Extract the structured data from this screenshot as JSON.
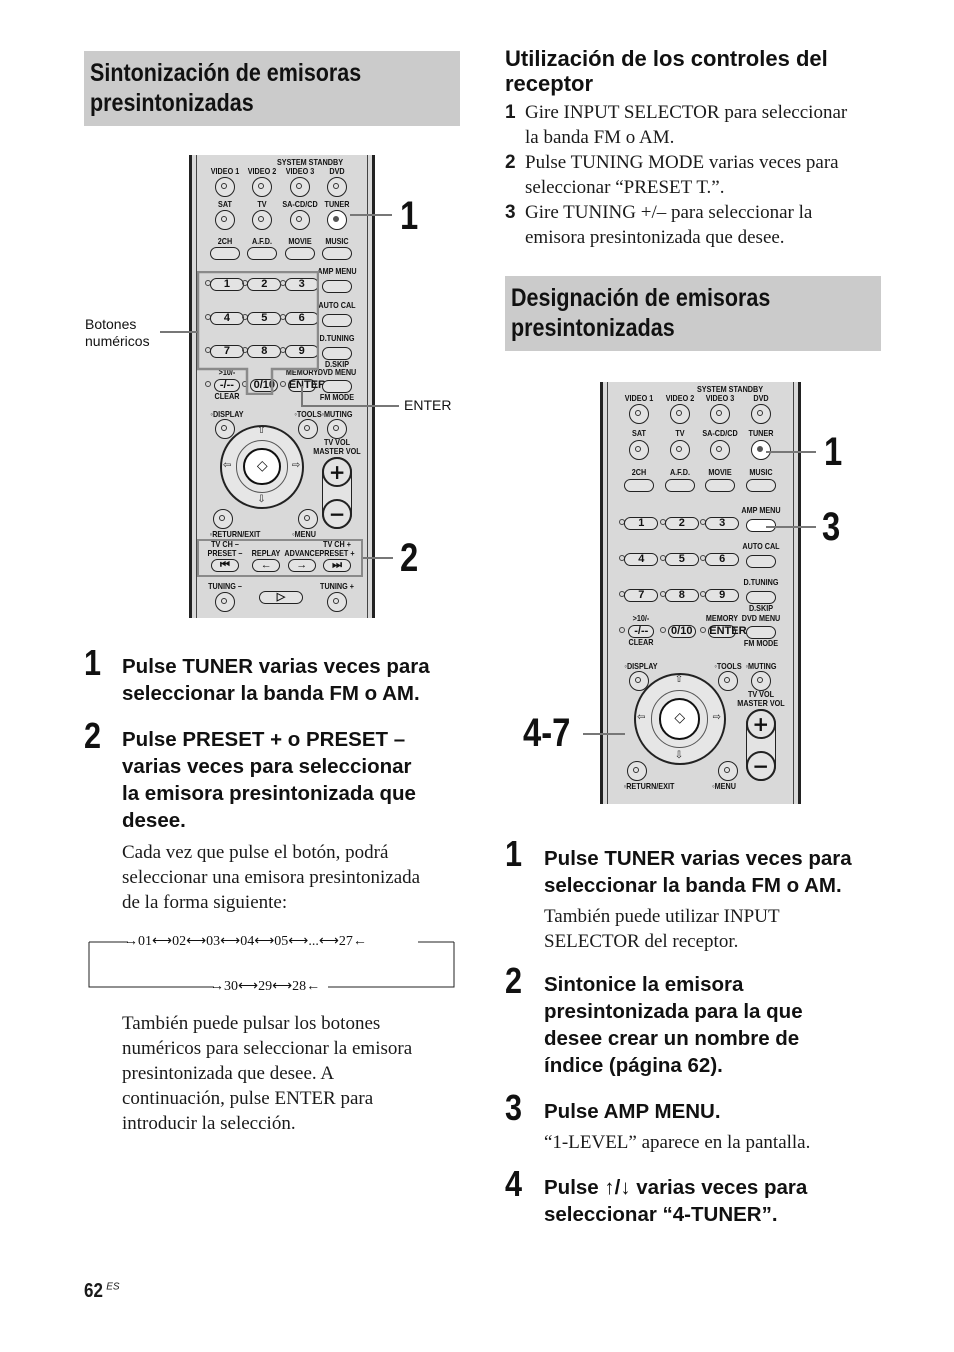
{
  "left": {
    "section_title_line1": "Sintonización de emisoras",
    "section_title_line2": "presintonizadas",
    "annotations": {
      "numeric_buttons_line1": "Botones",
      "numeric_buttons_line2": "numéricos",
      "enter": "ENTER"
    },
    "callouts": [
      "1",
      "2"
    ],
    "steps": [
      {
        "num": "1",
        "title_lines": [
          "Pulse TUNER varias veces para",
          "seleccionar la banda FM o AM."
        ]
      },
      {
        "num": "2",
        "title_lines": [
          "Pulse PRESET + o PRESET –",
          "varias veces para seleccionar",
          "la emisora presintonizada que",
          "desee."
        ],
        "body_lines": [
          "Cada vez que pulse el botón, podrá",
          "seleccionar una emisora presintonizada",
          "de la forma siguiente:"
        ]
      }
    ],
    "sequence": {
      "top": [
        "01",
        "02",
        "03",
        "04",
        "05",
        "...",
        "27"
      ],
      "bottom": [
        "30",
        "29",
        "28"
      ]
    },
    "note_lines": [
      "También puede pulsar los botones",
      "numéricos para seleccionar la emisora",
      "presintonizada que desee. A",
      "continuación, pulse ENTER para",
      "introducir la selección."
    ]
  },
  "right": {
    "subheading_line1": "Utilización de los controles del",
    "subheading_line2": "receptor",
    "receiver_steps": [
      {
        "num": "1",
        "lines": [
          "Gire INPUT SELECTOR para seleccionar",
          "la banda FM o AM."
        ]
      },
      {
        "num": "2",
        "lines": [
          "Pulse TUNING MODE varias veces para",
          "seleccionar “PRESET T.”."
        ]
      },
      {
        "num": "3",
        "lines": [
          "Gire TUNING +/– para seleccionar la",
          "emisora presintonizada que desee."
        ]
      }
    ],
    "section_title_line1": "Designación de emisoras",
    "section_title_line2": "presintonizadas",
    "callouts": [
      "1",
      "3",
      "4-7"
    ],
    "steps": [
      {
        "num": "1",
        "title_lines": [
          "Pulse TUNER varias veces para",
          "seleccionar la banda FM o AM."
        ],
        "body_lines": [
          "También puede utilizar INPUT",
          "SELECTOR del receptor."
        ]
      },
      {
        "num": "2",
        "title_lines": [
          "Sintonice la emisora",
          "presintonizada para la que",
          "desee crear un nombre de",
          "índice (página 62)."
        ]
      },
      {
        "num": "3",
        "title_lines": [
          "Pulse AMP MENU."
        ],
        "body_lines": [
          "“1-LEVEL” aparece en la pantalla."
        ]
      },
      {
        "num": "4",
        "title_lines": [
          "Pulse ↑/↓ varias veces para",
          "seleccionar “4-TUNER”."
        ]
      }
    ]
  },
  "remote": {
    "system_standby": "SYSTEM STANDBY",
    "row1": [
      "VIDEO 1",
      "VIDEO 2",
      "VIDEO 3",
      "DVD"
    ],
    "row2": [
      "SAT",
      "TV",
      "SA-CD/CD",
      "TUNER"
    ],
    "row3": [
      "2CH",
      "A.F.D.",
      "MOVIE",
      "MUSIC"
    ],
    "digits": [
      "1",
      "2",
      "3",
      "4",
      "5",
      "6",
      "7",
      "8",
      "9"
    ],
    "side": [
      "AMP MENU",
      "AUTO CAL",
      "D.TUNING",
      "D.SKIP",
      "DVD MENU",
      "FM MODE"
    ],
    "ten": ">10/-",
    "dash": "-/--",
    "clear": "CLEAR",
    "zero": "0/10",
    "memory": "MEMORY",
    "enter": "ENTER",
    "display": "DISPLAY",
    "tools": "TOOLS",
    "muting": "MUTING",
    "tv_vol": "TV VOL",
    "master_vol": "MASTER VOL",
    "return": "RETURN/EXIT",
    "menu": "MENU",
    "tvch_minus": "TV CH –",
    "preset_minus": "PRESET –",
    "replay": "REPLAY",
    "advance": "ADVANCE",
    "tvch_plus": "TV CH +",
    "preset_plus": "PRESET +",
    "tuning_minus": "TUNING –",
    "tuning_plus": "TUNING +"
  },
  "footer": {
    "page": "62",
    "suffix": "ES"
  }
}
